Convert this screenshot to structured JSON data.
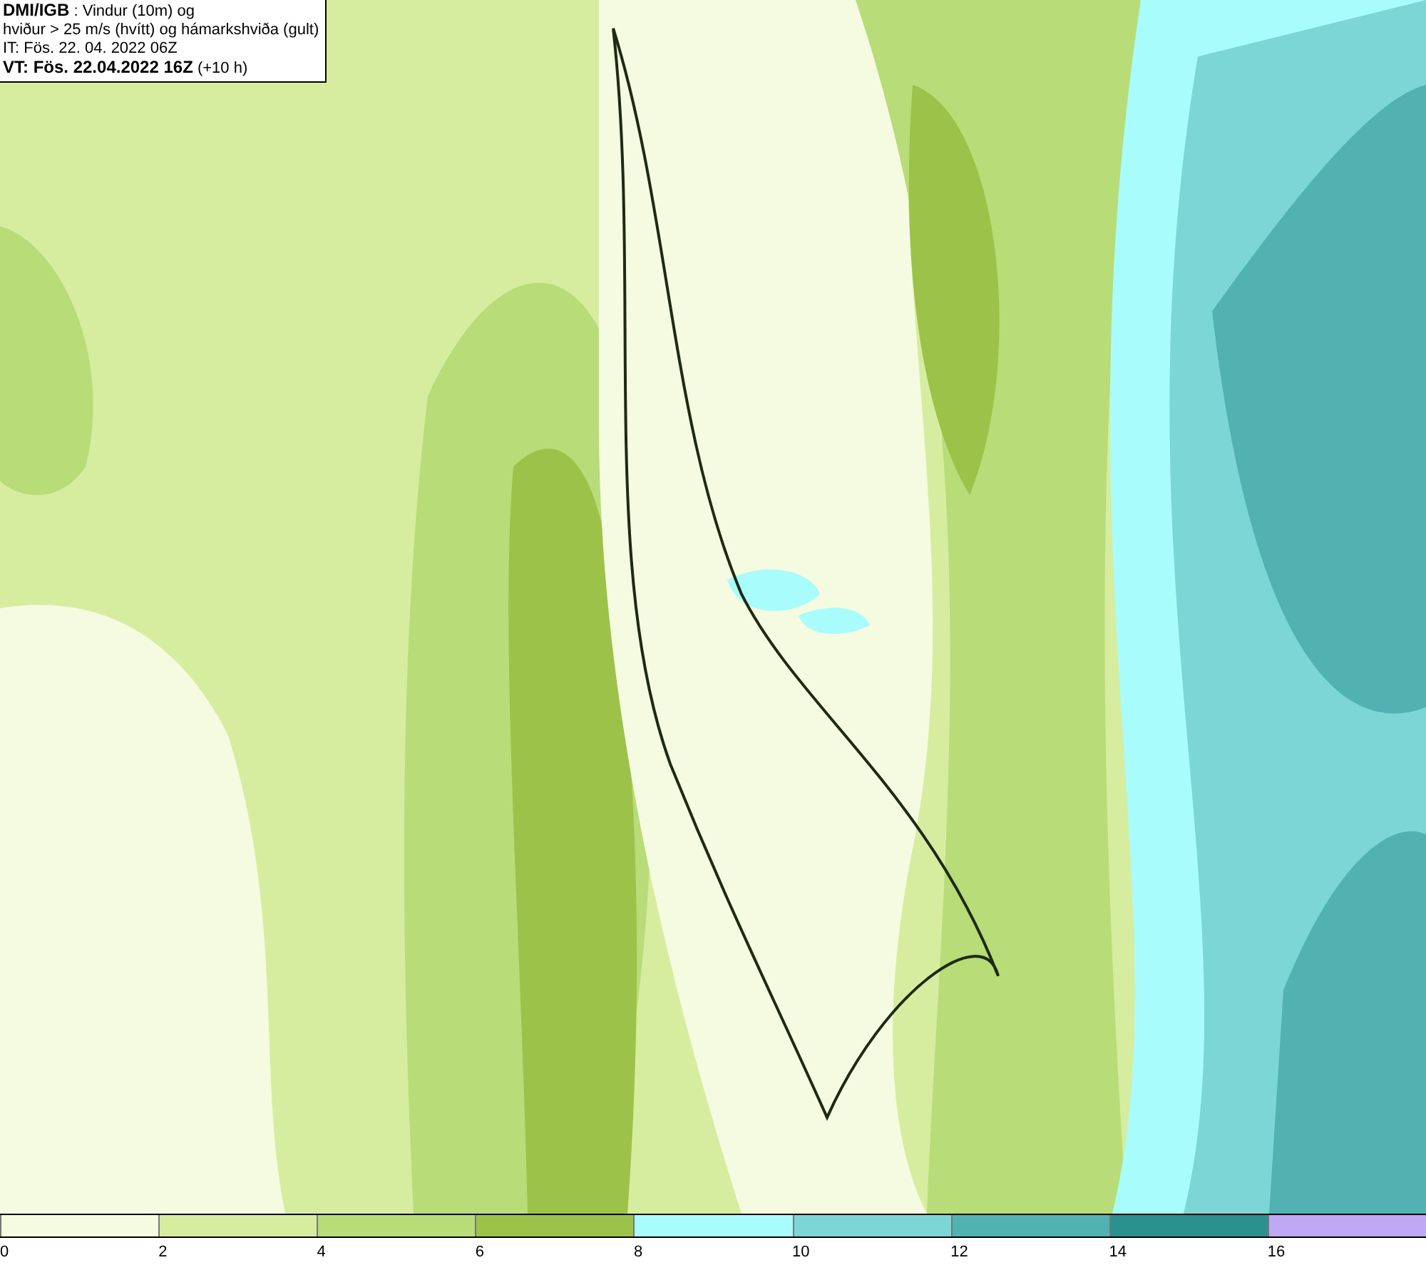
{
  "header": {
    "lines": [
      "**DMI/IGB** : Vindur (10m) og",
      "hviður > 25 m/s (hvítt) og hámarkshviða (gult)",
      "IT: Fös. 22. 04. 2022 06Z",
      "**VT: Fös. 22.04.2022 16Z** (+10 h)"
    ]
  },
  "legend": {
    "bins": [
      {
        "color": "#f5fbe0",
        "label": "0"
      },
      {
        "color": "#d6eda0",
        "label": "2"
      },
      {
        "color": "#b8dc78",
        "label": "4"
      },
      {
        "color": "#9cc24a",
        "label": "6"
      },
      {
        "color": "#a8fcfc",
        "label": "8"
      },
      {
        "color": "#7dd6d6",
        "label": "10"
      },
      {
        "color": "#52b2b2",
        "label": "12"
      },
      {
        "color": "#2a9090",
        "label": "14"
      },
      {
        "color": "#c0a8f4",
        "label": "16"
      }
    ]
  }
}
